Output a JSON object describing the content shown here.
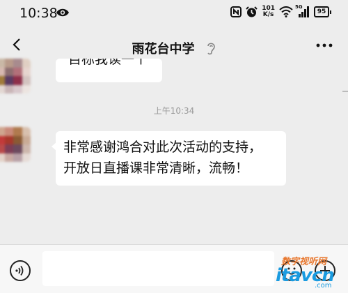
{
  "status_bar": {
    "time": "10:38",
    "net_speed_value": "101",
    "net_speed_unit": "K/s",
    "signal_label": "5G",
    "battery": "95"
  },
  "header": {
    "title": "雨花台中学"
  },
  "chat": {
    "messages": [
      {
        "text": "目标我读一个"
      },
      {
        "text": "非常感谢鸿合对此次活动的支持，\n开放日直播课非常清晰，流畅！"
      }
    ],
    "timestamp": "上午10:34"
  },
  "input_bar": {
    "message_value": ""
  },
  "watermark": {
    "brand_cn": "数字视听网",
    "brand_en": "itavcn",
    "domain": ".com"
  },
  "colors": {
    "background": "#ededed",
    "bubble": "#ffffff",
    "input_bar": "#f7f7f7",
    "watermark_blue": "#1a9be0",
    "watermark_orange": "#e8772e"
  }
}
